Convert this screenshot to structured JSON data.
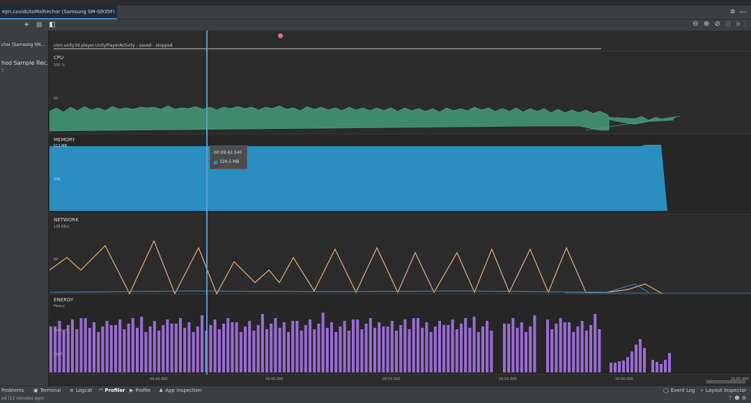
{
  "tab": {
    "session_title": "epn.covidcitoMalhechor (Samsung SM-G935F)"
  },
  "toolbar": {
    "add": "+",
    "stop": "■",
    "split": "◧",
    "zoom_out": "⊖",
    "zoom_in": "⊕",
    "reset_zoom": "⊘",
    "pause": "◍",
    "go_live": "▶|"
  },
  "sessions": {
    "device": "chor (Samsung SM...",
    "method": "hod Sample Rec...",
    "method_sub": "7"
  },
  "activity": {
    "label": "com.unity3d.player.UnityPlayerActivity - saved - stopped"
  },
  "cpu": {
    "title": "CPU",
    "axis_top": "100 %",
    "axis_mid": "50"
  },
  "memory": {
    "title": "MEMORY",
    "axis_top": "512 MB",
    "axis_mid": "256",
    "color": "#2a8fc0"
  },
  "network": {
    "title": "NETWORK",
    "axis_top": "128 KB/s",
    "axis_mid": "64",
    "color": "#e8b27a"
  },
  "energy": {
    "title": "ENERGY",
    "axis_top": "Heavy",
    "axis_mid": "Medium",
    "axis_low": "Light",
    "color": "#9b6bd6"
  },
  "tooltip": {
    "time": "00:09:42.540",
    "value": "329.5 MB"
  },
  "time_axis": {
    "ticks": [
      "09:40.000",
      "09:45.000",
      "09:50.000",
      "09:55.000",
      "10:00.000",
      "10:05.000"
    ]
  },
  "bottom_bar": {
    "problems": "Problems",
    "terminal": "Terminal",
    "logcat": "Logcat",
    "profiler": "Profiler",
    "profile": "Profile",
    "app_inspection": "App Inspection",
    "event_log": "Event Log",
    "layout_inspector": "Layout Inspector"
  },
  "status": {
    "text": "ed (12 minutes ago)"
  }
}
